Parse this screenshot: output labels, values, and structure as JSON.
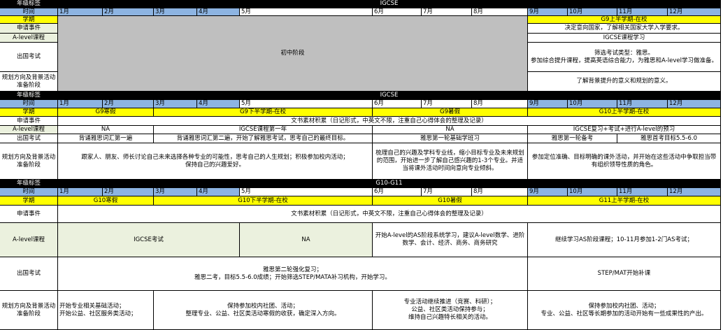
{
  "stages": [
    {
      "grade_label": "年级标签",
      "grade_value": "IGCSE",
      "time_label": "时间",
      "months": [
        "1月",
        "2月",
        "3月",
        "4月",
        "5月",
        "6月",
        "7月",
        "8月",
        "9月",
        "10月",
        "11月",
        "12月"
      ],
      "term_label": "学期",
      "terms": [
        "G9上半学期-在校"
      ],
      "application_label": "申请事件",
      "application_text": "决定意向国家，了解相关国家大学入学要求。",
      "alevel_label": "A-level课程",
      "alevel_text": "IGCSE课程学习",
      "middle_school": "初中阶段",
      "exam_label": "出国考试",
      "exam_text": "筛选考试类型：雅思。\n参加综合提升课程，提高英语综合能力，为雅思和A-level学习做准备。",
      "plan_label": "规划方向及背景活动准备阶段",
      "plan_text": "了解背景提升的意义和规划的意义。"
    },
    {
      "grade_label": "年级标签",
      "grade_value": "IGCSE",
      "time_label": "时间",
      "months": [
        "1月",
        "2月",
        "3月",
        "4月",
        "5月",
        "6月",
        "7月",
        "8月",
        "9月",
        "10月",
        "11月",
        "12月"
      ],
      "term_label": "学期",
      "terms": [
        "G9寒假",
        "G9下半学期-在校",
        "G9暑假",
        "G10上半学期-在校"
      ],
      "application_label": "申请事件",
      "application_text": "文书素材积累（日记形式，中英文不限，注重自己心得体会的整理及记录）",
      "alevel_label": "A-level课程",
      "alevel_items": [
        "NA",
        "IGCSE课程第一年",
        "NA",
        "IGCSE复习+考试+进行A-level的预习"
      ],
      "exam_label": "出国考试",
      "exam_items": [
        "背诵雅思词汇第一遍",
        "背诵雅思词汇第二遍，开始了解雅思考试，思考自己的最终目标。",
        "雅思第一轮基础学班习",
        "雅思第一轮备考",
        "雅思首考目标5.5-6.0"
      ],
      "plan_label": "规划方向及背景活动准备阶段",
      "plan_items": [
        "跟家人、朋友、师长讨论自己未来选择各种专业的可能性，思考自己的人生规划；积极参加校内活动；\n保持自己的兴趣爱好。",
        "梳理自己的兴趣及学科专业线，缩小目标专业及未来规划的范围，开始进一步了解自己感兴趣的1-3个专业。并适当将课外活动时间向意向专业倾斜。",
        "参加定位准确、目标明确的课外活动，并开始在这些活动中争取担当带有组织领导性质的角色。"
      ]
    },
    {
      "grade_label": "年级标签",
      "grade_value": "G10-G11",
      "time_label": "时间",
      "months": [
        "1月",
        "2月",
        "3月",
        "4月",
        "5月",
        "6月",
        "7月",
        "8月",
        "9月",
        "10月",
        "11月",
        "12月"
      ],
      "term_label": "学期",
      "terms": [
        "G10寒假",
        "G10下半学期-在校",
        "G10暑假",
        "G11上半学期-在校"
      ],
      "application_label": "申请事件",
      "application_text": "文书素材积累（日记形式，中英文不限，注重自己心得体会的整理及记录）",
      "alevel_label": "A-level课程",
      "alevel_items": [
        "IGCSE考试",
        "NA",
        "开始A-level的AS阶段系统学习，建议A-level数学、进阶数学、会计、经济、商务、商务研究",
        "继续学习AS阶段课程；10-11月参加1-2门AS考试；"
      ],
      "exam_label": "出国考试",
      "exam_items": [
        "雅思第二轮强化复习；\n雅思二考，目标5.5-6.0成绩；开始筛选STEP/MATA补习机构，开始学习。",
        "STEP/MAT开始补课"
      ],
      "plan_label": "规划方向及背景活动准备阶段",
      "plan_items": [
        "开始专业相关基础活动；\n开始公益、社区服务类活动；",
        "保持参加校内社团、活动；\n整理专业、公益、社区类活动寒假的收获，确定深入方向。",
        "专业活动继续推进（竞赛、科研）；\n公益、社区类活动保持参与；\n维持自己兴趣特长相关的活动。",
        "保持参加校内社团、活动；\n专业、公益、社区等长期参加的活动开始有一些成果性的产出。"
      ]
    }
  ]
}
